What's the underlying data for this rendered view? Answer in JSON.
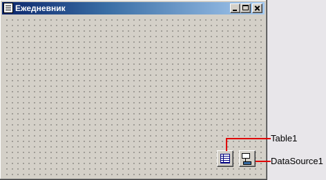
{
  "window": {
    "title": "Ежедневник",
    "icon": "form-icon",
    "caption_buttons": [
      "minimize-icon",
      "maximize-icon",
      "close-icon"
    ]
  },
  "components": {
    "table": {
      "label": "Table1",
      "icon": "table-component-icon"
    },
    "datasource": {
      "label": "DataSource1",
      "icon": "datasource-component-icon"
    }
  },
  "colors": {
    "callout": "#e00000",
    "form_background": "#d4d0c8",
    "title_gradient_start": "#0a246a",
    "title_gradient_end": "#a6caf0"
  }
}
